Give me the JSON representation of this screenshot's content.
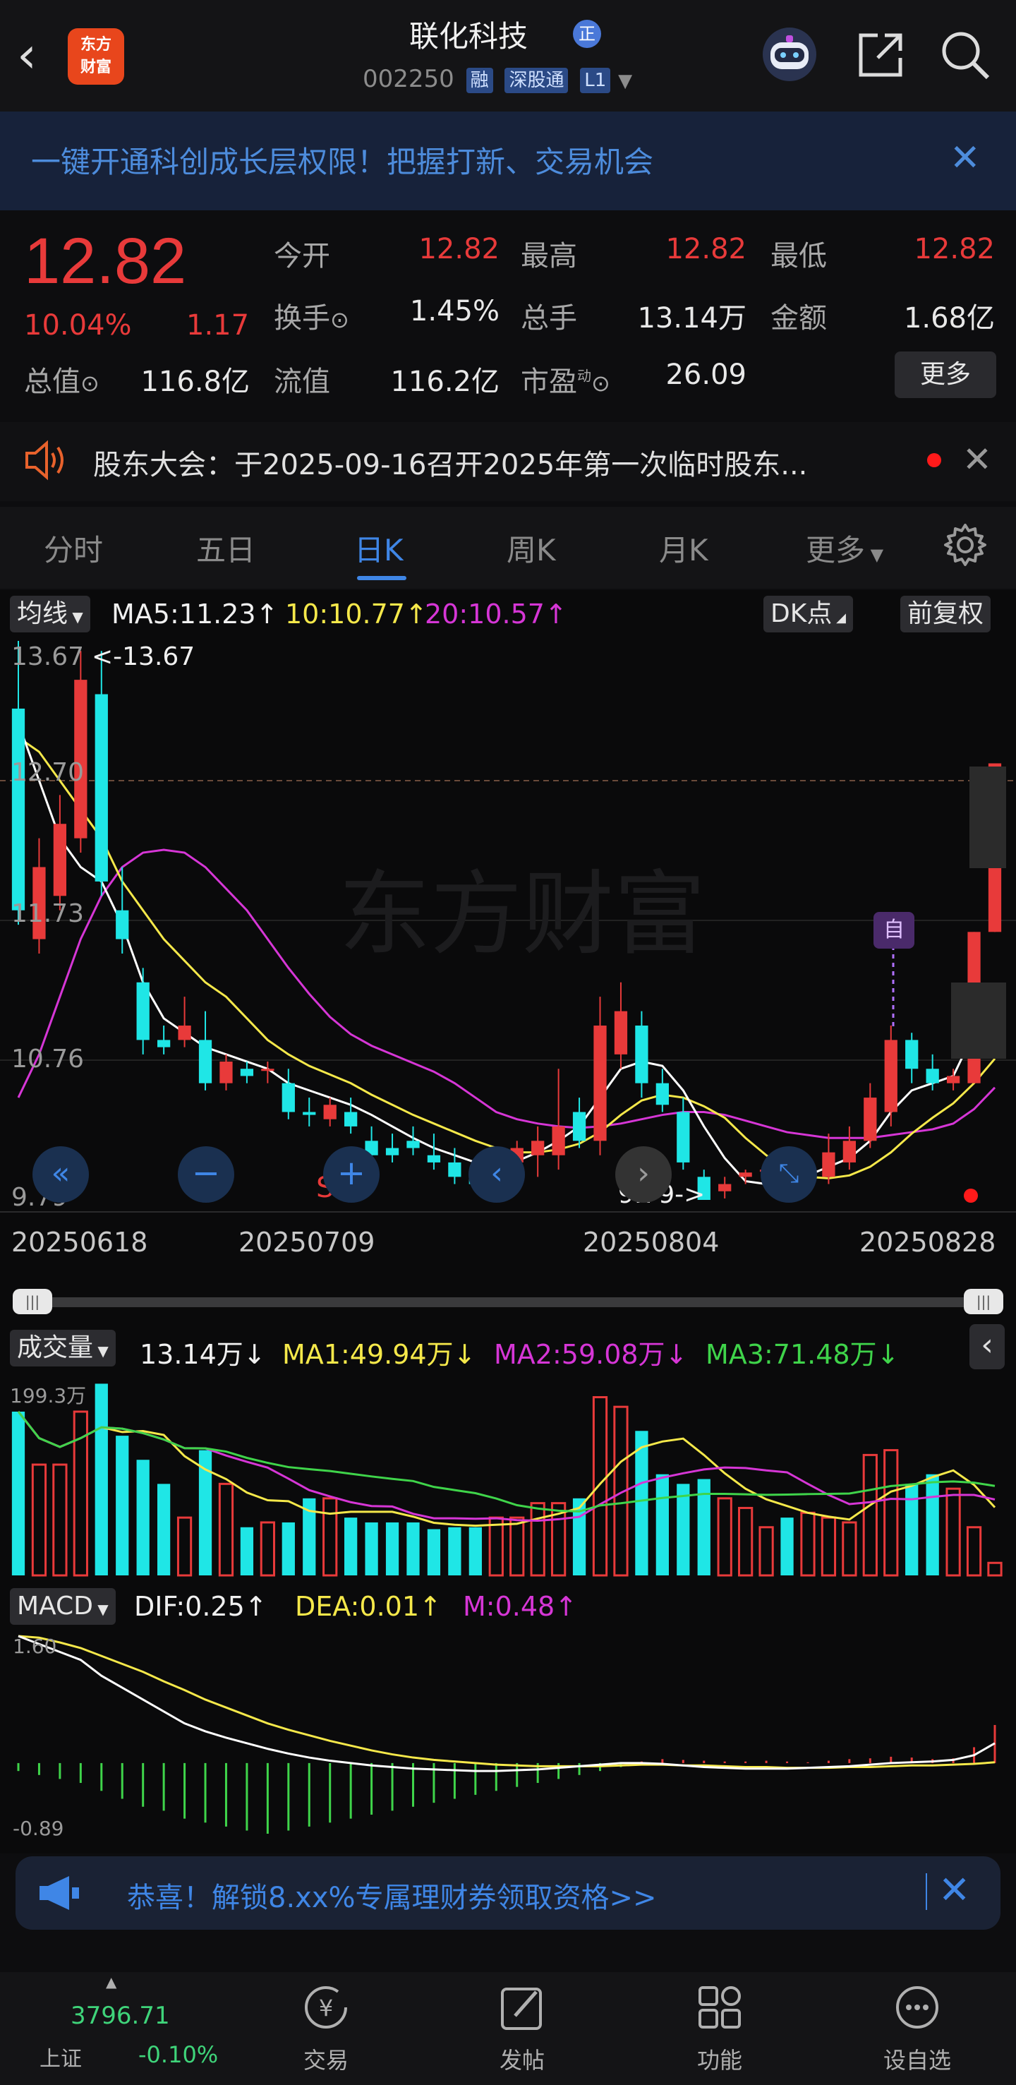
{
  "header": {
    "stock_name": "联化科技",
    "badge_zheng": "正",
    "code": "002250",
    "tags": [
      "融",
      "深股通",
      "L1"
    ],
    "logo_text_1": "东方",
    "logo_text_2": "财富"
  },
  "banner": {
    "text": "一键开通科创成长层权限！把握打新、交易机会"
  },
  "quote": {
    "price": "12.82",
    "change_pct": "10.04%",
    "change": "1.17",
    "open_label": "今开",
    "open": "12.82",
    "high_label": "最高",
    "high": "12.82",
    "low_label": "最低",
    "low": "12.82",
    "turnover_label": "换手",
    "turnover": "1.45%",
    "volume_label": "总手",
    "volume": "13.14万",
    "amount_label": "金额",
    "amount": "1.68亿",
    "mcap_label": "总值",
    "mcap": "116.8亿",
    "float_label": "流值",
    "float": "116.2亿",
    "pe_label": "市盈",
    "pe_sup": "动",
    "pe": "26.09",
    "more_button": "更多"
  },
  "notice": {
    "text": "股东大会：于2025-09-16召开2025年第一次临时股东..."
  },
  "tabs": [
    "分时",
    "五日",
    "日K",
    "周K",
    "月K",
    "更多"
  ],
  "kline": {
    "indicator_select": "均线",
    "ma5": "MA5:11.23",
    "ma10": "10:10.77",
    "ma20": "20:10.57",
    "dk_button": "DK点",
    "adjust_button": "前复权",
    "y_top": "13.67",
    "y_2": "12.70",
    "y_3": "11.73",
    "y_4": "10.76",
    "y_bottom": "9.79",
    "max_marker": "<-13.67",
    "min_marker": "9.79->",
    "zi_marker": "自",
    "s_marker": "S",
    "dates": [
      "20250618",
      "20250709",
      "20250804",
      "20250828"
    ]
  },
  "volume": {
    "select": "成交量",
    "value": "13.14万",
    "ma1": "MA1:49.94万",
    "ma2": "MA2:59.08万",
    "ma3": "MA3:71.48万",
    "y_top": "199.3万"
  },
  "macd": {
    "select": "MACD",
    "dif": "DIF:0.25",
    "dea": "DEA:0.01",
    "m": "M:0.48",
    "y_top": "1.60",
    "y_bottom": "-0.89"
  },
  "ad": {
    "text": "恭喜！解锁8.xx%专属理财券领取资格>>"
  },
  "bottom_nav": {
    "index_value": "3796.71",
    "index_name": "上证",
    "index_pct": "-0.10%",
    "items": [
      "交易",
      "发帖",
      "功能",
      "设自选"
    ]
  },
  "colors": {
    "up": "#e83a3a",
    "down": "#1fe6e6",
    "ma5": "#ffffff",
    "ma10": "#f5e84a",
    "ma20": "#d636d6",
    "accent": "#3f86e6"
  },
  "chart_data": {
    "type": "candlestick",
    "candles": [
      {
        "o": 11.8,
        "c": 13.2,
        "h": 13.67,
        "l": 11.7,
        "up": false
      },
      {
        "o": 11.6,
        "c": 12.1,
        "h": 12.3,
        "l": 11.5,
        "up": true
      },
      {
        "o": 11.9,
        "c": 12.4,
        "h": 12.6,
        "l": 11.8,
        "up": true
      },
      {
        "o": 12.3,
        "c": 13.4,
        "h": 13.6,
        "l": 12.2,
        "up": true
      },
      {
        "o": 13.3,
        "c": 12.0,
        "h": 13.6,
        "l": 11.9,
        "up": false
      },
      {
        "o": 11.8,
        "c": 11.6,
        "h": 12.1,
        "l": 11.5,
        "up": false
      },
      {
        "o": 11.3,
        "c": 10.9,
        "h": 11.4,
        "l": 10.8,
        "up": false
      },
      {
        "o": 10.9,
        "c": 10.85,
        "h": 11.0,
        "l": 10.8,
        "up": false
      },
      {
        "o": 10.9,
        "c": 11.0,
        "h": 11.2,
        "l": 10.85,
        "up": true
      },
      {
        "o": 10.9,
        "c": 10.6,
        "h": 11.1,
        "l": 10.55,
        "up": false
      },
      {
        "o": 10.6,
        "c": 10.75,
        "h": 10.8,
        "l": 10.55,
        "up": true
      },
      {
        "o": 10.7,
        "c": 10.65,
        "h": 10.75,
        "l": 10.6,
        "up": false
      },
      {
        "o": 10.7,
        "c": 10.7,
        "h": 10.75,
        "l": 10.6,
        "up": true
      },
      {
        "o": 10.6,
        "c": 10.4,
        "h": 10.7,
        "l": 10.35,
        "up": false
      },
      {
        "o": 10.4,
        "c": 10.38,
        "h": 10.5,
        "l": 10.3,
        "up": false
      },
      {
        "o": 10.35,
        "c": 10.45,
        "h": 10.5,
        "l": 10.3,
        "up": true
      },
      {
        "o": 10.4,
        "c": 10.3,
        "h": 10.5,
        "l": 10.25,
        "up": false
      },
      {
        "o": 10.2,
        "c": 10.1,
        "h": 10.3,
        "l": 10.05,
        "up": false
      },
      {
        "o": 10.15,
        "c": 10.1,
        "h": 10.25,
        "l": 10.05,
        "up": false
      },
      {
        "o": 10.2,
        "c": 10.15,
        "h": 10.3,
        "l": 10.1,
        "up": false
      },
      {
        "o": 10.1,
        "c": 10.05,
        "h": 10.25,
        "l": 10.0,
        "up": false
      },
      {
        "o": 10.05,
        "c": 9.95,
        "h": 10.15,
        "l": 9.9,
        "up": false
      },
      {
        "o": 9.95,
        "c": 9.9,
        "h": 10.0,
        "l": 9.85,
        "up": false
      },
      {
        "o": 9.95,
        "c": 10.1,
        "h": 10.15,
        "l": 9.9,
        "up": true
      },
      {
        "o": 10.05,
        "c": 10.15,
        "h": 10.2,
        "l": 10.0,
        "up": true
      },
      {
        "o": 10.1,
        "c": 10.2,
        "h": 10.3,
        "l": 9.95,
        "up": true
      },
      {
        "o": 10.1,
        "c": 10.3,
        "h": 10.7,
        "l": 10.0,
        "up": true
      },
      {
        "o": 10.4,
        "c": 10.2,
        "h": 10.5,
        "l": 10.15,
        "up": false
      },
      {
        "o": 10.2,
        "c": 11.0,
        "h": 11.2,
        "l": 10.1,
        "up": true
      },
      {
        "o": 10.8,
        "c": 11.1,
        "h": 11.3,
        "l": 10.7,
        "up": true
      },
      {
        "o": 11.0,
        "c": 10.6,
        "h": 11.1,
        "l": 10.5,
        "up": false
      },
      {
        "o": 10.6,
        "c": 10.45,
        "h": 10.7,
        "l": 10.4,
        "up": false
      },
      {
        "o": 10.4,
        "c": 10.05,
        "h": 10.5,
        "l": 10.0,
        "up": false
      },
      {
        "o": 9.95,
        "c": 9.79,
        "h": 10.0,
        "l": 9.79,
        "up": false
      },
      {
        "o": 9.85,
        "c": 9.9,
        "h": 9.95,
        "l": 9.8,
        "up": true
      },
      {
        "o": 9.95,
        "c": 9.98,
        "h": 10.0,
        "l": 9.9,
        "up": true
      },
      {
        "o": 10.0,
        "c": 10.0,
        "h": 10.05,
        "l": 9.95,
        "up": true
      },
      {
        "o": 10.0,
        "c": 9.95,
        "h": 10.05,
        "l": 9.9,
        "up": false
      },
      {
        "o": 9.9,
        "c": 9.98,
        "h": 10.0,
        "l": 9.85,
        "up": true
      },
      {
        "o": 9.95,
        "c": 10.12,
        "h": 10.25,
        "l": 9.9,
        "up": true
      },
      {
        "o": 10.05,
        "c": 10.2,
        "h": 10.3,
        "l": 10.0,
        "up": true
      },
      {
        "o": 10.2,
        "c": 10.5,
        "h": 10.6,
        "l": 10.15,
        "up": true
      },
      {
        "o": 10.4,
        "c": 10.9,
        "h": 11.0,
        "l": 10.3,
        "up": true
      },
      {
        "o": 10.9,
        "c": 10.7,
        "h": 10.95,
        "l": 10.6,
        "up": false
      },
      {
        "o": 10.7,
        "c": 10.6,
        "h": 10.8,
        "l": 10.55,
        "up": false
      },
      {
        "o": 10.6,
        "c": 10.65,
        "h": 10.7,
        "l": 10.55,
        "up": true
      },
      {
        "o": 10.6,
        "c": 11.65,
        "h": 11.65,
        "l": 10.6,
        "up": true
      },
      {
        "o": 11.65,
        "c": 12.82,
        "h": 12.82,
        "l": 11.65,
        "up": true
      }
    ],
    "ma5": [
      13.1,
      12.7,
      12.3,
      12.1,
      12.0,
      11.7,
      11.3,
      11.05,
      10.95,
      10.85,
      10.8,
      10.75,
      10.7,
      10.6,
      10.55,
      10.5,
      10.45,
      10.38,
      10.3,
      10.22,
      10.15,
      10.1,
      10.05,
      10.03,
      10.06,
      10.12,
      10.2,
      10.3,
      10.5,
      10.7,
      10.75,
      10.72,
      10.55,
      10.3,
      10.08,
      9.92,
      9.9,
      9.93,
      9.96,
      10.02,
      10.08,
      10.2,
      10.4,
      10.55,
      10.6,
      10.65,
      10.95,
      11.23
    ],
    "ma10": [
      13.0,
      12.9,
      12.7,
      12.5,
      12.3,
      12.0,
      11.8,
      11.6,
      11.45,
      11.3,
      11.2,
      11.05,
      10.9,
      10.8,
      10.72,
      10.66,
      10.6,
      10.52,
      10.45,
      10.38,
      10.32,
      10.26,
      10.2,
      10.15,
      10.12,
      10.12,
      10.14,
      10.18,
      10.26,
      10.38,
      10.48,
      10.52,
      10.5,
      10.44,
      10.36,
      10.22,
      10.1,
      10.0,
      9.95,
      9.94,
      9.96,
      10.02,
      10.12,
      10.25,
      10.36,
      10.46,
      10.6,
      10.77
    ],
    "ma20": [
      10.5,
      10.8,
      11.2,
      11.6,
      11.9,
      12.1,
      12.2,
      12.22,
      12.2,
      12.1,
      11.95,
      11.8,
      11.6,
      11.4,
      11.22,
      11.06,
      10.94,
      10.86,
      10.8,
      10.74,
      10.68,
      10.6,
      10.5,
      10.4,
      10.35,
      10.32,
      10.3,
      10.29,
      10.3,
      10.32,
      10.35,
      10.38,
      10.4,
      10.4,
      10.38,
      10.34,
      10.3,
      10.26,
      10.24,
      10.22,
      10.22,
      10.22,
      10.24,
      10.26,
      10.28,
      10.32,
      10.42,
      10.57
    ],
    "volume": [
      170,
      115,
      115,
      170,
      199,
      145,
      120,
      95,
      60,
      130,
      95,
      50,
      55,
      55,
      80,
      80,
      60,
      55,
      55,
      55,
      48,
      50,
      50,
      60,
      60,
      75,
      75,
      80,
      185,
      175,
      150,
      105,
      95,
      100,
      80,
      70,
      50,
      60,
      65,
      60,
      55,
      125,
      130,
      95,
      105,
      90,
      50,
      13
    ],
    "macd_m": [
      -0.1,
      -0.15,
      -0.2,
      -0.25,
      -0.35,
      -0.45,
      -0.55,
      -0.6,
      -0.7,
      -0.75,
      -0.8,
      -0.85,
      -0.89,
      -0.85,
      -0.8,
      -0.75,
      -0.7,
      -0.65,
      -0.6,
      -0.55,
      -0.5,
      -0.45,
      -0.4,
      -0.35,
      -0.3,
      -0.25,
      -0.2,
      -0.15,
      -0.1,
      -0.05,
      0.02,
      0.05,
      0.04,
      0.03,
      0.02,
      0.02,
      0.03,
      0.02,
      0.01,
      0.03,
      0.05,
      0.06,
      0.08,
      0.07,
      0.05,
      0.06,
      0.2,
      0.48
    ],
    "macd_dif": [
      1.6,
      1.5,
      1.4,
      1.3,
      1.1,
      0.95,
      0.8,
      0.65,
      0.5,
      0.4,
      0.32,
      0.25,
      0.18,
      0.12,
      0.07,
      0.03,
      0.0,
      -0.03,
      -0.05,
      -0.07,
      -0.08,
      -0.09,
      -0.1,
      -0.1,
      -0.09,
      -0.08,
      -0.06,
      -0.04,
      -0.02,
      0.0,
      0.0,
      -0.01,
      -0.03,
      -0.05,
      -0.06,
      -0.07,
      -0.07,
      -0.07,
      -0.06,
      -0.05,
      -0.04,
      -0.02,
      0.0,
      0.01,
      0.02,
      0.04,
      0.1,
      0.25
    ],
    "macd_dea": [
      1.6,
      1.58,
      1.52,
      1.45,
      1.35,
      1.25,
      1.15,
      1.03,
      0.92,
      0.8,
      0.7,
      0.6,
      0.5,
      0.42,
      0.35,
      0.28,
      0.22,
      0.16,
      0.11,
      0.07,
      0.04,
      0.02,
      0.0,
      -0.02,
      -0.03,
      -0.04,
      -0.04,
      -0.04,
      -0.04,
      -0.03,
      -0.02,
      -0.02,
      -0.03,
      -0.03,
      -0.04,
      -0.05,
      -0.05,
      -0.06,
      -0.06,
      -0.06,
      -0.05,
      -0.05,
      -0.04,
      -0.03,
      -0.03,
      -0.02,
      -0.01,
      0.01
    ]
  }
}
